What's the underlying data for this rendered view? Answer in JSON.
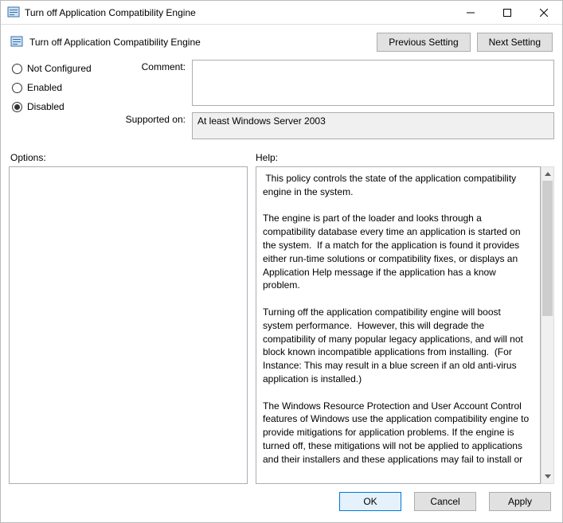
{
  "window": {
    "title": "Turn off Application Compatibility Engine",
    "header_title": "Turn off Application Compatibility Engine"
  },
  "nav": {
    "previous": "Previous Setting",
    "next": "Next Setting"
  },
  "radios": {
    "not_configured": "Not Configured",
    "enabled": "Enabled",
    "disabled": "Disabled",
    "selected": "disabled"
  },
  "fields": {
    "comment_label": "Comment:",
    "comment_value": "",
    "supported_label": "Supported on:",
    "supported_value": "At least Windows Server 2003"
  },
  "labels": {
    "options": "Options:",
    "help": "Help:"
  },
  "help_text": " This policy controls the state of the application compatibility engine in the system.\n\nThe engine is part of the loader and looks through a compatibility database every time an application is started on the system.  If a match for the application is found it provides either run-time solutions or compatibility fixes, or displays an Application Help message if the application has a know problem.\n\nTurning off the application compatibility engine will boost system performance.  However, this will degrade the compatibility of many popular legacy applications, and will not block known incompatible applications from installing.  (For Instance: This may result in a blue screen if an old anti-virus application is installed.)\n\nThe Windows Resource Protection and User Account Control features of Windows use the application compatibility engine to provide mitigations for application problems. If the engine is turned off, these mitigations will not be applied to applications and their installers and these applications may fail to install or",
  "buttons": {
    "ok": "OK",
    "cancel": "Cancel",
    "apply": "Apply"
  }
}
